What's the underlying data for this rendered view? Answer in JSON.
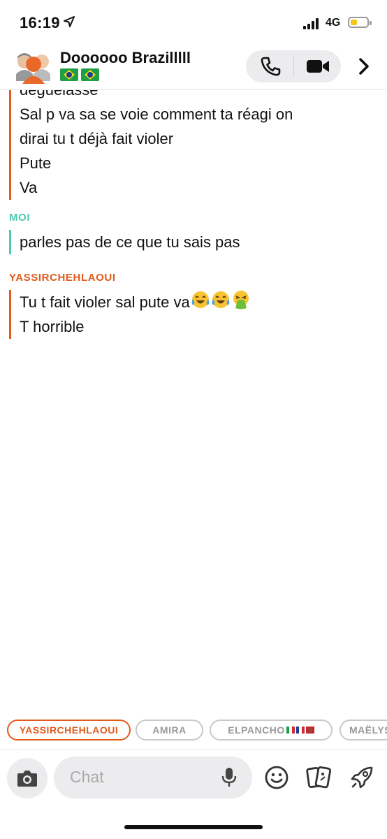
{
  "status_bar": {
    "time": "16:19",
    "network": "4G",
    "battery_color": "#f5c518"
  },
  "header": {
    "title": "Doooooo Brazilllll",
    "flags": [
      "brazil-flag",
      "brazil-flag"
    ]
  },
  "colors": {
    "accent_other": "#e25a1c",
    "accent_me": "#4fc9b0"
  },
  "messages": {
    "block1_lines": [
      "déguelasse",
      "Sal p va sa se voie comment ta réagi on",
      "dirai tu t déjà fait violer",
      "Pute",
      "Va"
    ],
    "me_sender": "MOI",
    "me_line": "parles pas de ce que tu sais pas",
    "other_sender": "YASSIRCHEHLAOUI",
    "block3_line1": "Tu t fait violer sal pute va",
    "block3_line2": "T horrible"
  },
  "participants": [
    "YASSIRCHEHLAOUI",
    "AMIRA",
    "ELPANCHO",
    "MAËLYS"
  ],
  "composer": {
    "placeholder": "Chat"
  }
}
